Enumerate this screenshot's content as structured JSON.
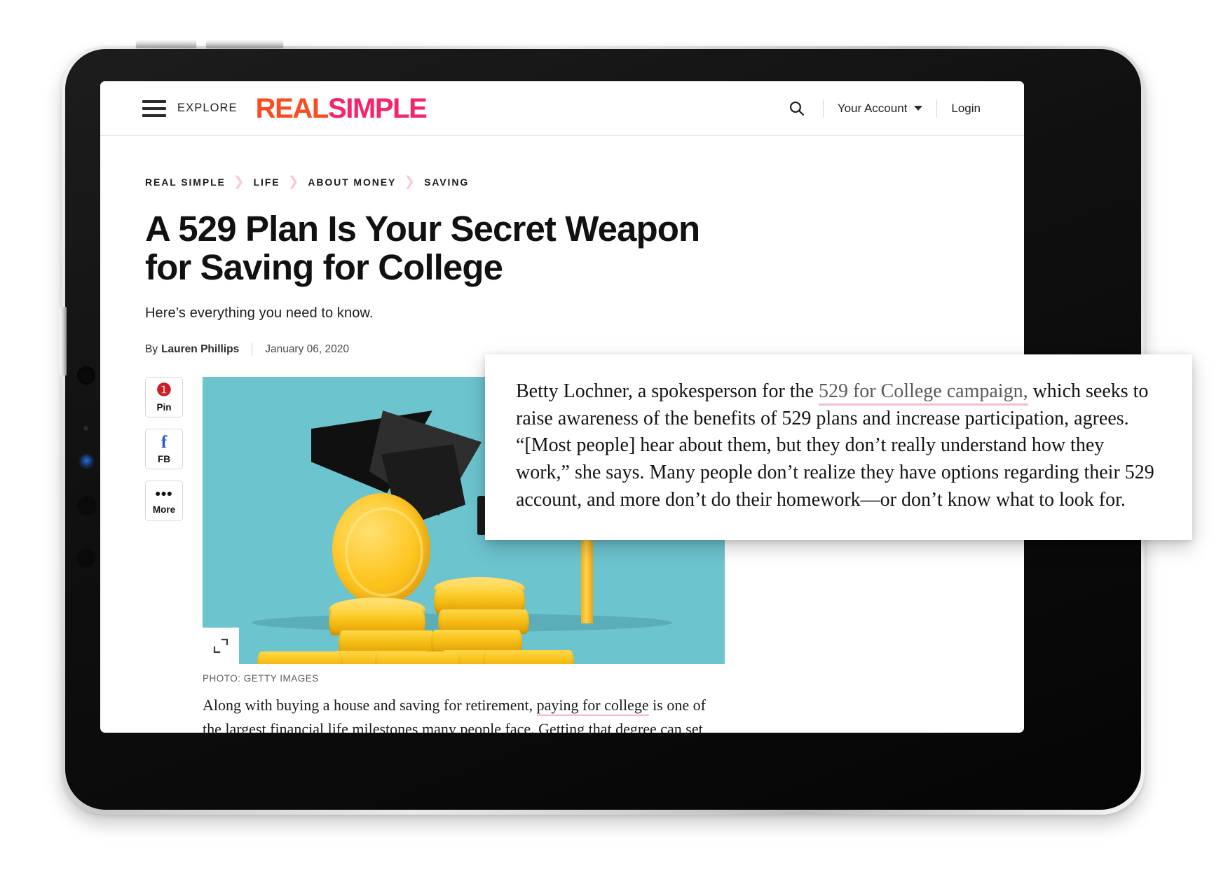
{
  "header": {
    "menu_label": "EXPLORE",
    "brand_first": "REAL",
    "brand_second": "SIMPLE",
    "search_icon": "search-icon",
    "account_label": "Your Account",
    "login_label": "Login"
  },
  "breadcrumb": [
    "REAL SIMPLE",
    "LIFE",
    "ABOUT MONEY",
    "SAVING"
  ],
  "article": {
    "headline": "A 529 Plan Is Your Secret Weapon for Saving for College",
    "dek": "Here’s everything you need to know.",
    "by_prefix": "By",
    "author": "Lauren Phillips",
    "date": "January 06, 2020",
    "photo_credit": "PHOTO: GETTY IMAGES",
    "body_part1": "Along with buying a house and saving for retirement, ",
    "body_link": "paying for college",
    "body_part2": " is one of the largest financial life milestones many people face. Getting that degree can set graduates up for success and higher wages throughout their lifetime, but it also comes with a huge price tag—one that keeps growing."
  },
  "share": [
    {
      "icon": "pinterest-icon",
      "glyph": "Ⓟ",
      "label": "Pin",
      "color": "#cb1f27"
    },
    {
      "icon": "facebook-icon",
      "glyph": "f",
      "label": "FB",
      "color": "#2b59c3"
    },
    {
      "icon": "more-options-icon",
      "glyph": "•••",
      "label": "More",
      "color": "#111111"
    }
  ],
  "callout": {
    "text_part1": "Betty Lochner, a spokesperson for the ",
    "link": "529 for College campaign,",
    "text_part2": " which seeks to raise awareness of the benefits of 529 plans and increase participation, agrees. “[Most people] hear about them, but they don’t really understand how they work,” she says. Many people don’t realize they have options regarding their 529 account, and more don’t do their homework—or don’t know what to look for."
  },
  "hero": {
    "alt": "graduation cap with stacks of gold coins",
    "expand_icon": "expand-icon",
    "background_color": "#6cc4cf"
  },
  "colors": {
    "brand_orange": "#fa4b22",
    "brand_pink": "#f5246b",
    "link_underline": "#f7bcd0",
    "breadcrumb_chevron": "#f8c9d6",
    "hero_bg": "#6cc4cf",
    "coin_gold": "#f7c117"
  }
}
